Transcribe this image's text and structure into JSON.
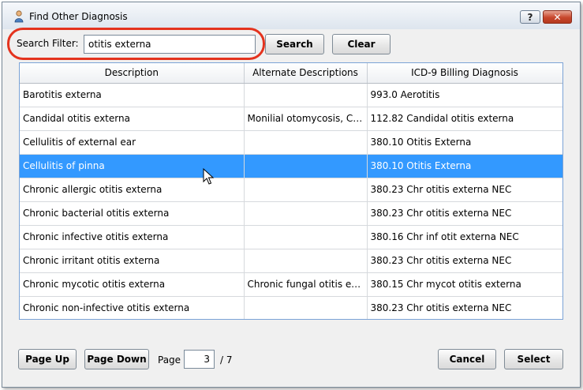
{
  "window": {
    "title": "Find Other Diagnosis",
    "help_label": "?",
    "close_label": "✕"
  },
  "filter": {
    "label": "Search Filter:",
    "value": "otitis externa",
    "search_label": "Search",
    "clear_label": "Clear"
  },
  "table": {
    "columns": [
      "Description",
      "Alternate Descriptions",
      "ICD-9 Billing Diagnosis"
    ],
    "selected_row": 3,
    "rows": [
      [
        "Barotitis externa",
        "",
        "993.0  Aerotitis"
      ],
      [
        "Candidal otitis externa",
        "Monilial otomycosis, Ca...",
        "112.82  Candidal otitis externa"
      ],
      [
        "Cellulitis of external ear",
        "",
        "380.10  Otitis Externa"
      ],
      [
        "Cellulitis of pinna",
        "",
        "380.10  Otitis Externa"
      ],
      [
        "Chronic allergic otitis externa",
        "",
        "380.23  Chr otitis externa NEC"
      ],
      [
        "Chronic bacterial otitis externa",
        "",
        "380.23  Chr otitis externa NEC"
      ],
      [
        "Chronic infective otitis externa",
        "",
        "380.16  Chr inf otit externa NEC"
      ],
      [
        "Chronic irritant otitis externa",
        "",
        "380.23  Chr otitis externa NEC"
      ],
      [
        "Chronic mycotic otitis externa",
        "Chronic fungal otitis ext...",
        "380.15  Chr mycot otitis externa"
      ],
      [
        "Chronic non-infective otitis externa",
        "",
        "380.23  Chr otitis externa NEC"
      ]
    ]
  },
  "footer": {
    "page_up_label": "Page Up",
    "page_down_label": "Page Down",
    "page_label": "Page",
    "page_value": "3",
    "page_total": "/ 7",
    "cancel_label": "Cancel",
    "select_label": "Select"
  },
  "colors": {
    "highlight_ring": "#e4331e",
    "selection": "#3399ff"
  }
}
